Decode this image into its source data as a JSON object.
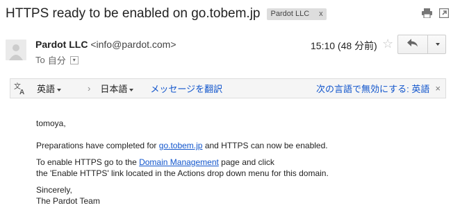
{
  "subject": "HTTPS ready to be enabled on go.tobem.jp",
  "label_chip": {
    "text": "Pardot LLC",
    "close": "x"
  },
  "top_icons": [
    "print-icon",
    "new-window-icon"
  ],
  "sender": {
    "name": "Pardot LLC",
    "email": "<info@pardot.com>"
  },
  "to_line": {
    "prefix": "To",
    "recipient": "自分"
  },
  "timestamp": "15:10 (48 分前)",
  "translate_bar": {
    "source_lang": "英語",
    "arrow": "›",
    "target_lang": "日本語",
    "translate_link": "メッセージを翻訳",
    "never_link": "次の言語で無効にする: 英語",
    "close": "×"
  },
  "body": {
    "greeting": "tomoya,",
    "p1_before": "Preparations have completed for ",
    "p1_link": "go.tobem.jp",
    "p1_after": " and HTTPS can now be enabled.",
    "p2_before": "To enable HTTPS go to the ",
    "p2_link": "Domain Management",
    "p2_after": " page and click",
    "p2_line2": "the 'Enable HTTPS' link located in the Actions drop down menu for this domain.",
    "signoff": "Sincerely,",
    "signature": "The Pardot Team"
  },
  "colors": {
    "link": "#1155cc",
    "chip_bg": "#dddddd",
    "bar_bg": "#f5f5f5"
  }
}
